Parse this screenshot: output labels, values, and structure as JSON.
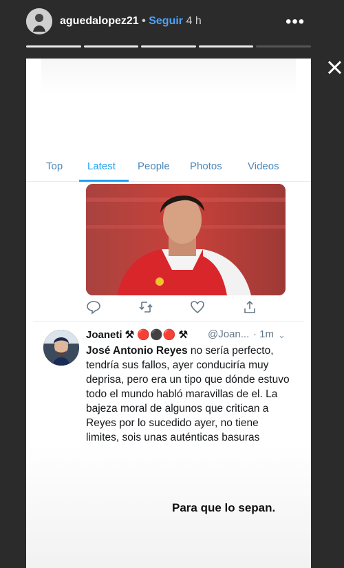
{
  "header": {
    "username": "aguedalopez21",
    "separator": "•",
    "follow_label": "Seguir",
    "time_ago": "4 h",
    "more_label": "•••",
    "close_icon": "close-icon"
  },
  "progress": {
    "segments_total": 5,
    "segments_filled": 4
  },
  "tabs": [
    {
      "label": "Top",
      "active": false
    },
    {
      "label": "Latest",
      "active": true
    },
    {
      "label": "People",
      "active": false
    },
    {
      "label": "Photos",
      "active": false
    },
    {
      "label": "Videos",
      "active": false
    }
  ],
  "tweet_actions": [
    "reply-icon",
    "retweet-icon",
    "like-icon",
    "share-icon"
  ],
  "tweet": {
    "name": "Joaneti ⚒ 🔴⚫🔴 ⚒",
    "handle": "@Joan...",
    "meta": "· 1m",
    "bold_intro": "José Antonio Reyes",
    "text": " no sería perfecto, tendría sus fallos, ayer conduciría muy deprisa, pero era un tipo que dónde estuvo todo el mundo habló maravillas de el. La bajeza moral de algunos que critican a Reyes por lo sucedido ayer, no tiene limites, sois unas auténticas basuras"
  },
  "caption": "Para que lo sepan.",
  "colors": {
    "twitter_blue": "#1da1f2",
    "follow_blue": "#4ea3ff",
    "story_bg": "#2b2b2b"
  }
}
